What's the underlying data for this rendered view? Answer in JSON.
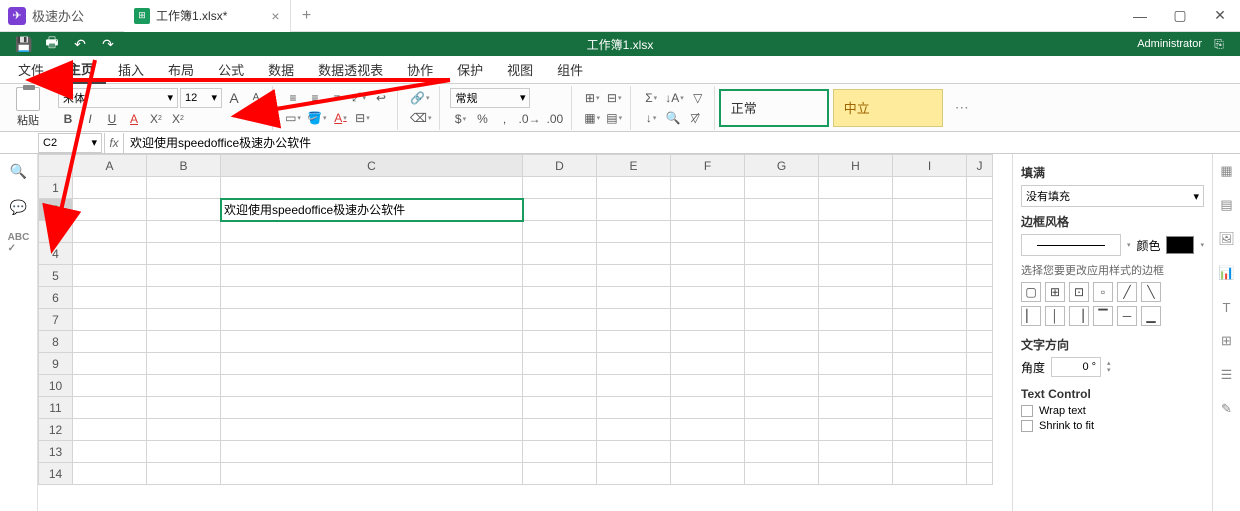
{
  "app": {
    "name": "极速办公"
  },
  "tab": {
    "title": "工作簿1.xlsx*"
  },
  "window": {
    "doc_title": "工作簿1.xlsx",
    "user": "Administrator"
  },
  "menu": {
    "items": [
      "文件",
      "主页",
      "插入",
      "布局",
      "公式",
      "数据",
      "数据透视表",
      "协作",
      "保护",
      "视图",
      "组件"
    ],
    "active": 1
  },
  "ribbon": {
    "paste": "粘贴",
    "font_name": "宋体",
    "font_size": "12",
    "number_format": "常规",
    "styles": {
      "normal": "正常",
      "neutral": "中立"
    }
  },
  "cellref": "C2",
  "formula": "欢迎使用speedoffice极速办公软件",
  "grid": {
    "cols": [
      "A",
      "B",
      "C",
      "D",
      "E",
      "F",
      "G",
      "H",
      "I",
      "J"
    ],
    "rows": 14,
    "active_row": 2,
    "active_col": "C",
    "cells": {
      "C2": "欢迎使用speedoffice极速办公软件"
    }
  },
  "sidepanel": {
    "fill_title": "填满",
    "fill_value": "没有填充",
    "border_style": "边框风格",
    "color_label": "颜色",
    "border_hint": "选择您要更改应用样式的边框",
    "text_dir": "文字方向",
    "angle_label": "角度",
    "angle_value": "0 °",
    "text_control": "Text Control",
    "wrap": "Wrap text",
    "shrink": "Shrink to fit"
  }
}
